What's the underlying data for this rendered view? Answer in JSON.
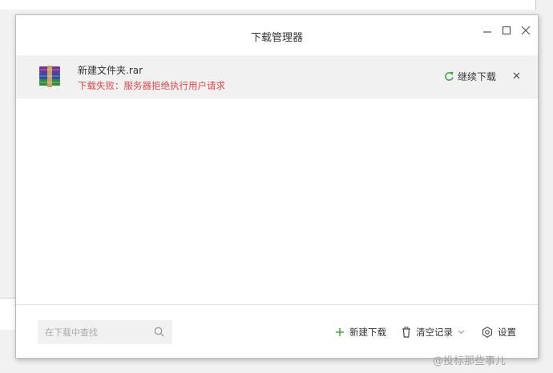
{
  "window": {
    "title": "下载管理器"
  },
  "download": {
    "file_name": "新建文件夹.rar",
    "status": "下载失败：服务器拒绝执行用户请求",
    "resume_label": "继续下载",
    "icon": "winrar-archive-icon"
  },
  "bottom": {
    "search_placeholder": "在下载中查找",
    "new_download_label": "新建下载",
    "clear_records_label": "清空记录",
    "settings_label": "设置"
  },
  "watermark": "@投标那些事儿",
  "colors": {
    "error": "#e24a4a",
    "resume_icon": "#3aa33a",
    "add_icon": "#3aa33a"
  }
}
